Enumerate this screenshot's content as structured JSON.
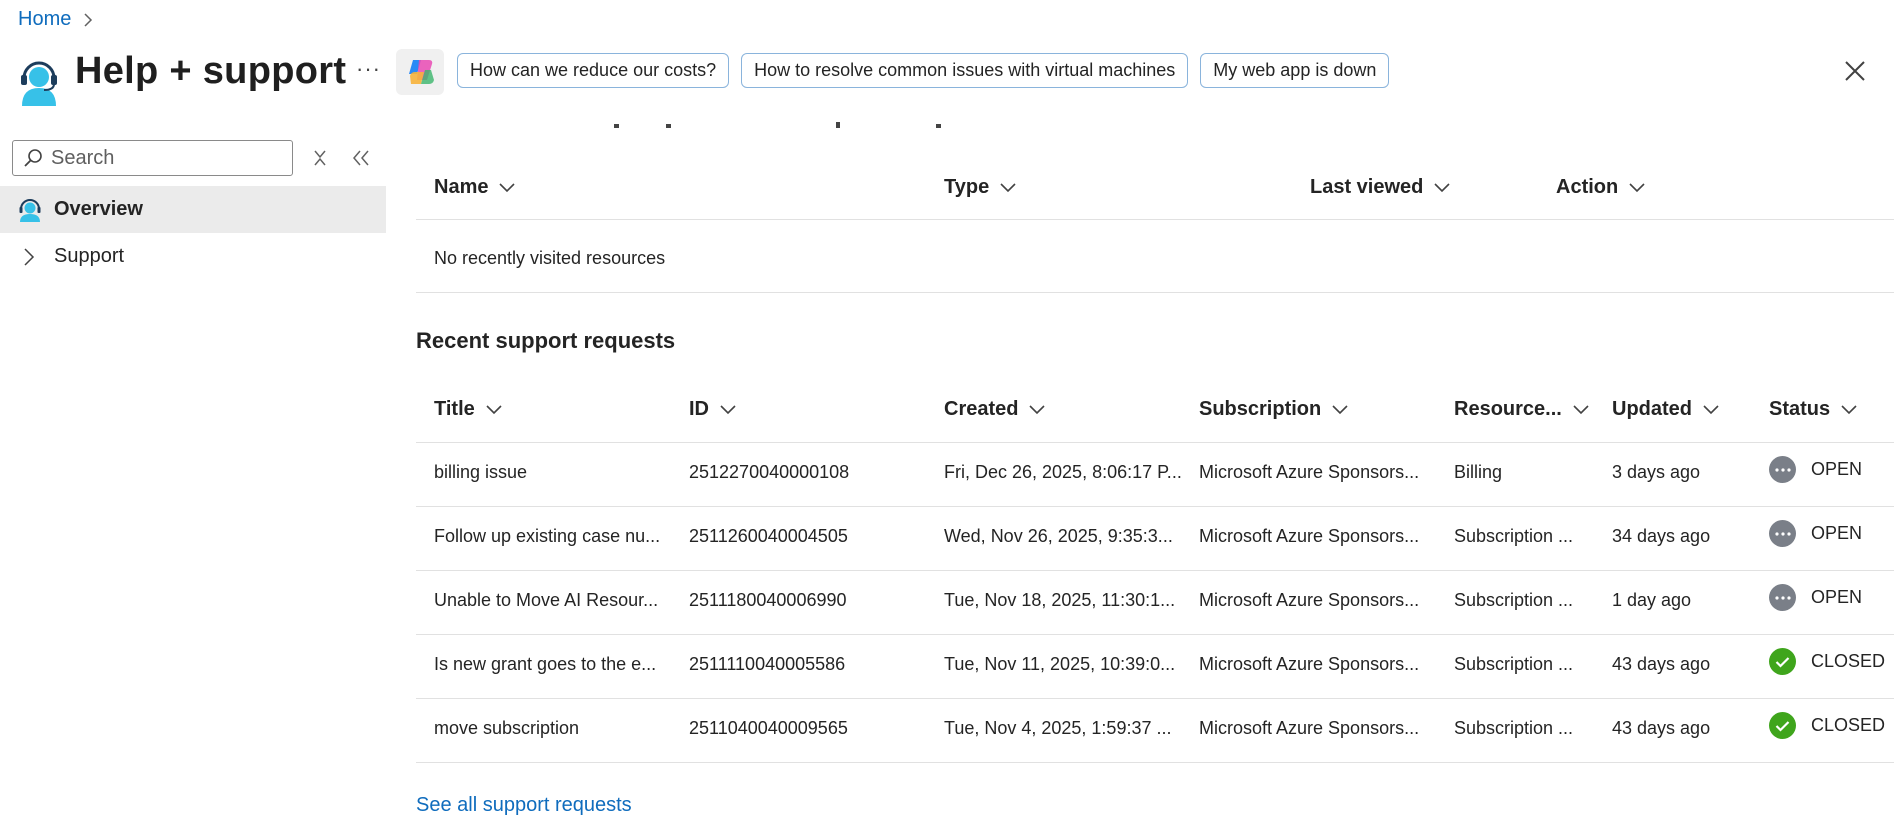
{
  "breadcrumb": {
    "home": "Home"
  },
  "header": {
    "title": "Help + support",
    "more": "···",
    "suggestions": [
      "How can we reduce our costs?",
      "How to resolve common issues with virtual machines",
      "My web app is down"
    ]
  },
  "sidebar": {
    "search_placeholder": "Search",
    "items": [
      {
        "label": "Overview",
        "active": true
      },
      {
        "label": "Support",
        "active": false
      }
    ]
  },
  "recent_resources": {
    "columns": [
      "Name",
      "Type",
      "Last viewed",
      "Action"
    ],
    "empty_message": "No recently visited resources"
  },
  "support_requests": {
    "title": "Recent support requests",
    "columns": [
      "Title",
      "ID",
      "Created",
      "Subscription",
      "Resource...",
      "Updated",
      "Status"
    ],
    "rows": [
      {
        "title": "billing issue",
        "id": "2512270040000108",
        "created": "Fri, Dec 26, 2025, 8:06:17 P...",
        "subscription": "Microsoft Azure Sponsors...",
        "resource": "Billing",
        "updated": "3 days ago",
        "status": "OPEN"
      },
      {
        "title": "Follow up existing case nu...",
        "id": "2511260040004505",
        "created": "Wed, Nov 26, 2025, 9:35:3...",
        "subscription": "Microsoft Azure Sponsors...",
        "resource": "Subscription ...",
        "updated": "34 days ago",
        "status": "OPEN"
      },
      {
        "title": "Unable to Move AI Resour...",
        "id": "2511180040006990",
        "created": "Tue, Nov 18, 2025, 11:30:1...",
        "subscription": "Microsoft Azure Sponsors...",
        "resource": "Subscription ...",
        "updated": "1 day ago",
        "status": "OPEN"
      },
      {
        "title": "Is new grant goes to the e...",
        "id": "2511110040005586",
        "created": "Tue, Nov 11, 2025, 10:39:0...",
        "subscription": "Microsoft Azure Sponsors...",
        "resource": "Subscription ...",
        "updated": "43 days ago",
        "status": "CLOSED"
      },
      {
        "title": "move subscription",
        "id": "2511040040009565",
        "created": "Tue, Nov 4, 2025, 1:59:37 ...",
        "subscription": "Microsoft Azure Sponsors...",
        "resource": "Subscription ...",
        "updated": "43 days ago",
        "status": "CLOSED"
      }
    ],
    "see_all": "See all support requests"
  },
  "icons": {
    "chevron": "chevron-down-icon",
    "status_open": "more-circle-icon",
    "status_closed": "checkmark-circle-icon"
  },
  "colors": {
    "link": "#0f6cbd",
    "open": "#7a7f88",
    "closed": "#3fa51c",
    "active_nav": "#ebebeb"
  }
}
